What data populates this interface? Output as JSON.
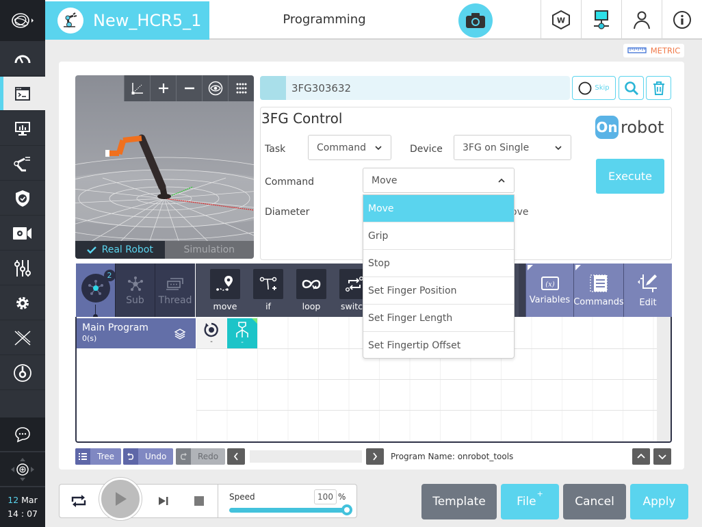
{
  "header": {
    "robot_name": "New_HCR5_1",
    "title": "Programming",
    "metric_label": "METRIC",
    "icons": [
      "camera-icon",
      "workspace-w-icon",
      "network-monitor-icon",
      "user-icon",
      "info-icon"
    ]
  },
  "sidebar": {
    "items": [
      {
        "name": "dashboard",
        "icon": "gauge-icon"
      },
      {
        "name": "programming",
        "icon": "terminal-window-icon",
        "active": true
      },
      {
        "name": "monitoring",
        "icon": "monitor-chart-icon"
      },
      {
        "name": "robot-settings",
        "icon": "robot-arm-icon"
      },
      {
        "name": "safety",
        "icon": "shield-check-icon"
      },
      {
        "name": "vision",
        "icon": "camera-gear-icon"
      },
      {
        "name": "io-settings",
        "icon": "sliders-icon"
      },
      {
        "name": "settings",
        "icon": "gear-icon"
      },
      {
        "name": "extensions",
        "icon": "x-icon"
      },
      {
        "name": "tool",
        "icon": "target-disc-icon"
      }
    ],
    "chat_icon": "chat-bubble-icon",
    "jog_icon": "jog-pad-icon",
    "date_day": "12",
    "date_month": "Mar",
    "time": "14 : 07"
  },
  "viewer": {
    "tools": [
      "axis-icon",
      "zoom-in-icon",
      "zoom-out-icon",
      "eye-icon",
      "grid-dots-icon"
    ],
    "tab_real": "Real Robot",
    "tab_sim": "Simulation",
    "active_tab": "Real Robot"
  },
  "command_bar": {
    "name": "3FG303632",
    "skip_label": "Skip"
  },
  "control": {
    "title": "3FG Control",
    "brand": "robot",
    "brand_mark": "On",
    "task_label": "Task",
    "task_value": "Command",
    "device_label": "Device",
    "device_value": "3FG on Single",
    "command_label": "Command",
    "command_value": "Move",
    "diameter_label": "Diameter",
    "hidden_text": "ove",
    "execute_label": "Execute",
    "command_options": [
      "Move",
      "Grip",
      "Stop",
      "Set Finger Position",
      "Set Finger Length",
      "Set Fingertip Offset"
    ],
    "selected_option": "Move"
  },
  "program": {
    "badge_count": "2",
    "tab_sub": "Sub",
    "tab_thread": "Thread",
    "tools": [
      {
        "label": "move",
        "icon": "move-waypoint-icon"
      },
      {
        "label": "if",
        "icon": "if-branch-icon"
      },
      {
        "label": "loop",
        "icon": "loop-icon"
      },
      {
        "label": "switch",
        "icon": "switch-icon"
      }
    ],
    "right_tools": [
      {
        "label": "Variables",
        "icon": "variables-icon"
      },
      {
        "label": "Commands",
        "icon": "commands-list-icon"
      },
      {
        "label": "Edit",
        "icon": "edit-crop-icon"
      }
    ],
    "main_program_label": "Main Program",
    "main_program_time": "0(s)",
    "nodes": [
      {
        "label": "-",
        "icon": "repeat-start-icon"
      },
      {
        "label": "-",
        "icon": "gripper-3fg-icon"
      }
    ]
  },
  "bottom_bar": {
    "tree": "Tree",
    "undo": "Undo",
    "redo": "Redo",
    "program_name": "Program Name: onrobot_tools"
  },
  "playbar": {
    "speed_label": "Speed",
    "speed_value": "100",
    "speed_unit": "%",
    "speed_fraction": 1.0
  },
  "actions": {
    "template": "Template",
    "file": "File",
    "file_sup": "+",
    "cancel": "Cancel",
    "apply": "Apply"
  }
}
